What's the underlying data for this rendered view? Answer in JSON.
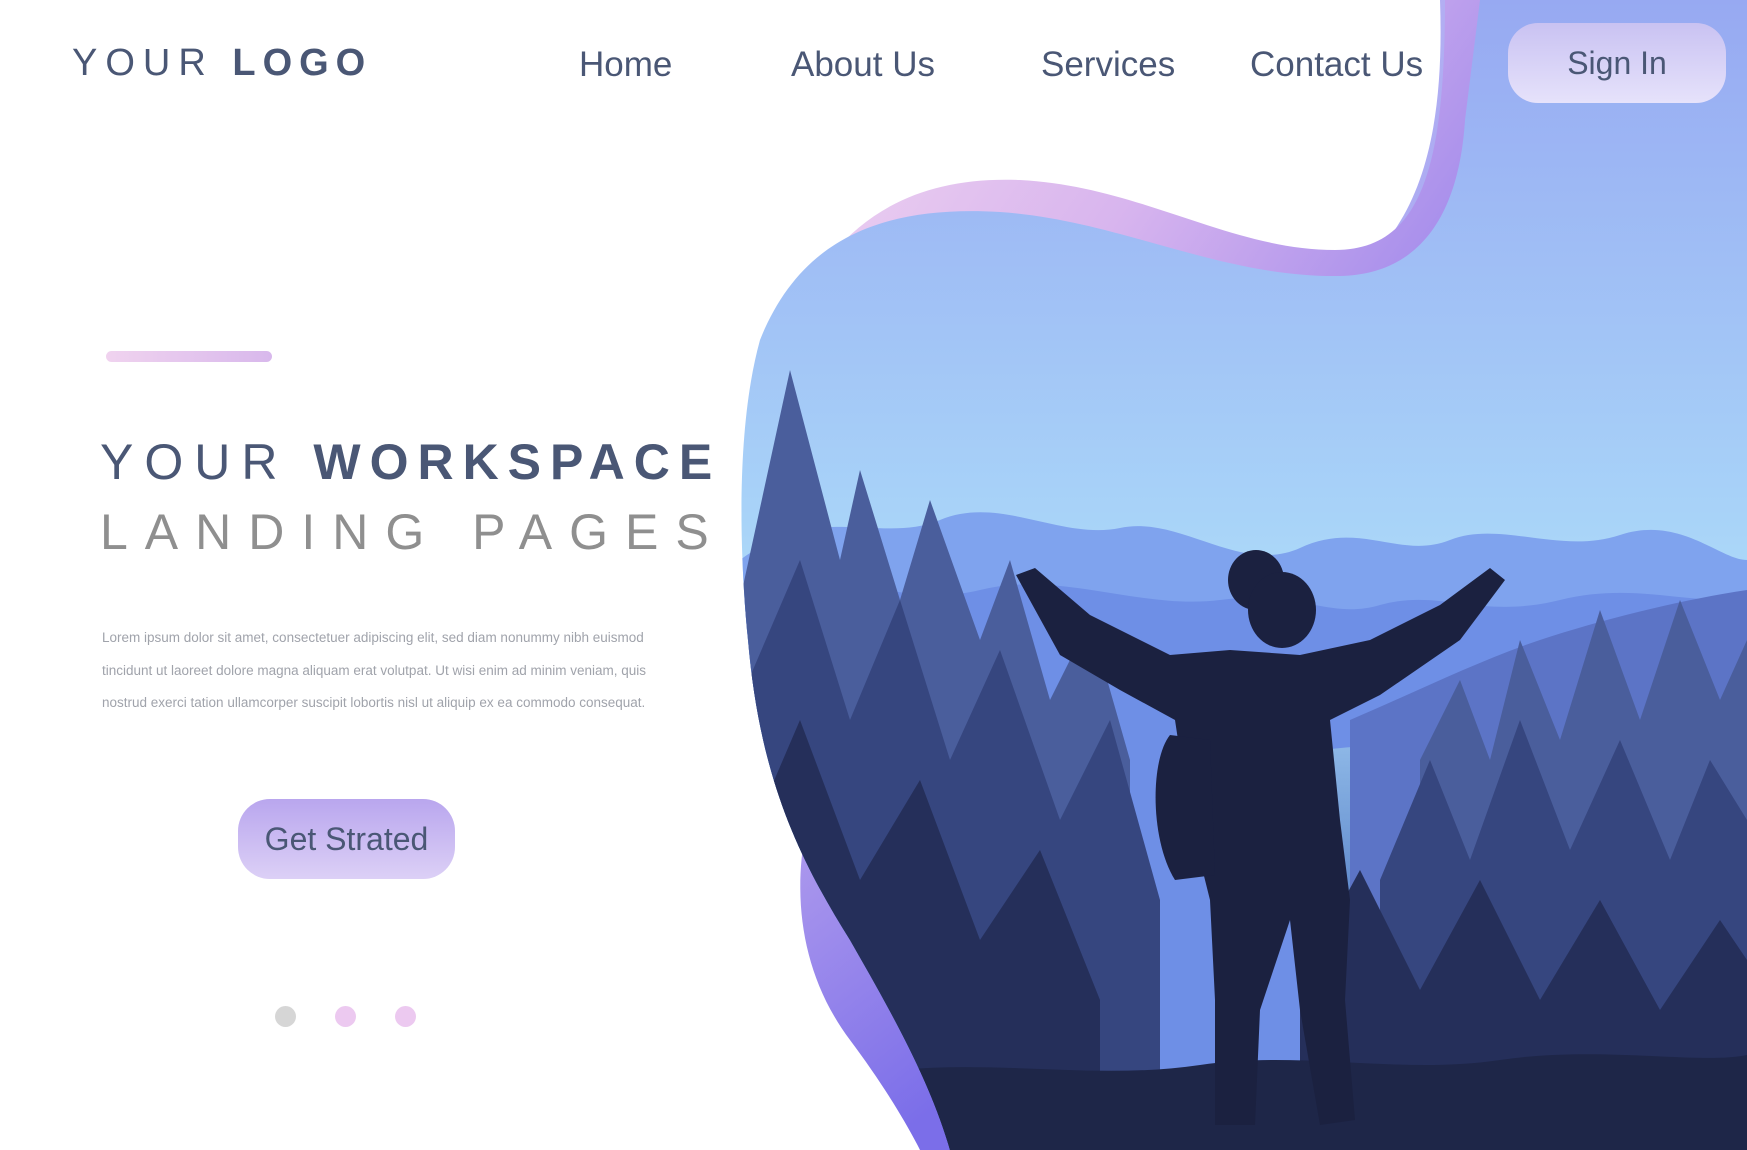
{
  "header": {
    "logo_regular": "YOUR",
    "logo_bold": "LOGO",
    "nav": [
      {
        "label": "Home"
      },
      {
        "label": "About Us"
      },
      {
        "label": "Services"
      },
      {
        "label": "Contact Us"
      }
    ],
    "signin_label": "Sign In"
  },
  "hero": {
    "headline_regular": "YOUR",
    "headline_bold": "WORKSPACE",
    "headline_line2": "LANDING PAGES",
    "body": "Lorem ipsum dolor sit amet, consectetuer adipiscing elit, sed diam nonummy nibh euismod tincidunt ut laoreet dolore magna aliquam erat volutpat. Ut wisi enim ad minim veniam, quis nostrud exerci tation ullamcorper suscipit lobortis nisl ut aliquip ex ea commodo consequat.",
    "cta_label": "Get Strated"
  },
  "carousel": {
    "active_index": 0,
    "dots": [
      {
        "color": "#d6d6d6"
      },
      {
        "color": "#ecc9f0"
      },
      {
        "color": "#ecc9f0"
      }
    ]
  },
  "colors": {
    "text_dark": "#4a5775",
    "text_gray": "#8f8f8f",
    "accent_purple": "#8f8cef",
    "accent_pink": "#f2d5ee"
  }
}
